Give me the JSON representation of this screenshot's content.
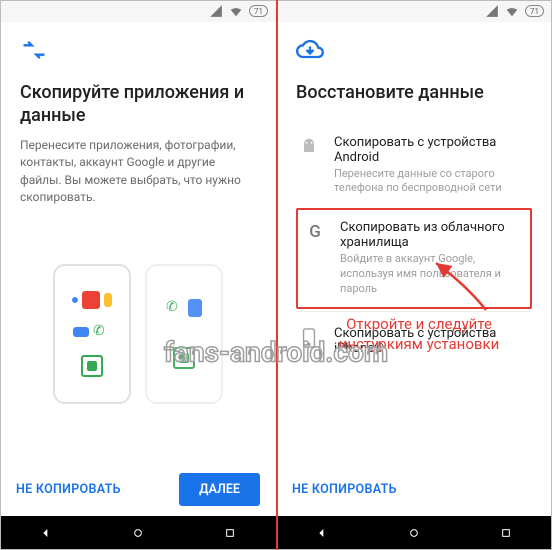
{
  "statusbar": {
    "battery": "71"
  },
  "left": {
    "title": "Скопируйте приложения и данные",
    "subtitle": "Перенесите приложения, фотографии, контакты, аккаунт Google и другие файлы. Вы можете выбрать, что нужно скопировать.",
    "skip": "НЕ КОПИРОВАТЬ",
    "next": "ДАЛЕЕ"
  },
  "right": {
    "title": "Восстановите данные",
    "options": [
      {
        "title": "Скопировать с устройства Android",
        "subtitle": "Перенесите данные со старого телефона по беспроводной сети",
        "icon": "android"
      },
      {
        "title": "Скопировать из облачного хранилища",
        "subtitle": "Войдите в аккаунт Google, используя имя пользователя и пароль",
        "icon": "google",
        "highlight": true
      },
      {
        "title": "Скопировать с устройства iPhone®",
        "subtitle": "",
        "icon": "iphone"
      }
    ],
    "skip": "НЕ КОПИРОВАТЬ"
  },
  "annotation": {
    "line1": "Откройте и следуйте",
    "line2": "инстуркиям установки"
  },
  "watermark": "fans-android.com"
}
